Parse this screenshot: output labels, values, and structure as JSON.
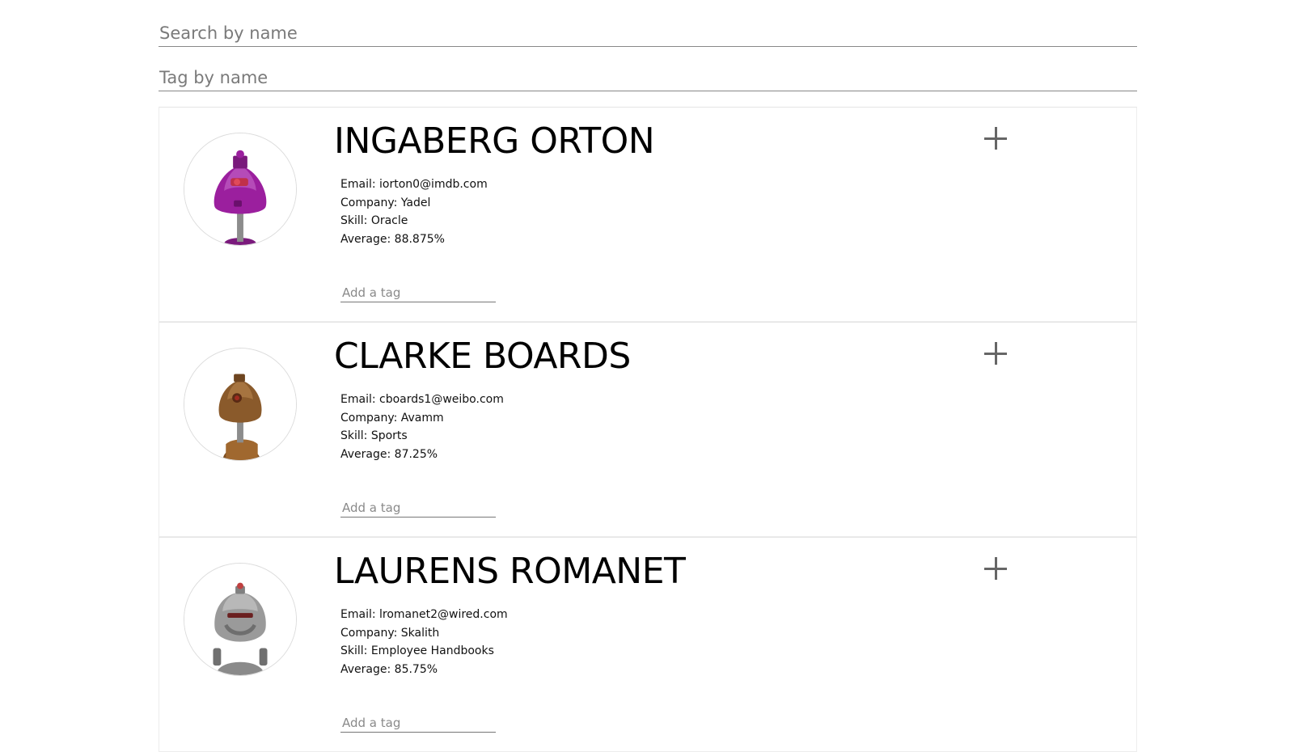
{
  "search": {
    "name_placeholder": "Search by name",
    "tag_placeholder": "Tag by name"
  },
  "students": [
    {
      "name": "INGABERG ORTON",
      "email": "Email: iorton0@imdb.com",
      "company": "Company: Yadel",
      "skill": "Skill: Oracle",
      "average": "Average: 88.875%",
      "avatar_color": "#9b1f9e",
      "tag_placeholder": "Add a tag"
    },
    {
      "name": "CLARKE BOARDS",
      "email": "Email: cboards1@weibo.com",
      "company": "Company: Avamm",
      "skill": "Skill: Sports",
      "average": "Average: 87.25%",
      "avatar_color": "#8a5a2b",
      "tag_placeholder": "Add a tag"
    },
    {
      "name": "LAURENS ROMANET",
      "email": "Email: lromanet2@wired.com",
      "company": "Company: Skalith",
      "skill": "Skill: Employee Handbooks",
      "average": "Average: 85.75%",
      "avatar_color": "#9a9a9a",
      "tag_placeholder": "Add a tag"
    }
  ],
  "icons": {
    "expand": "plus-icon",
    "avatar": "robot-avatar-icon"
  }
}
